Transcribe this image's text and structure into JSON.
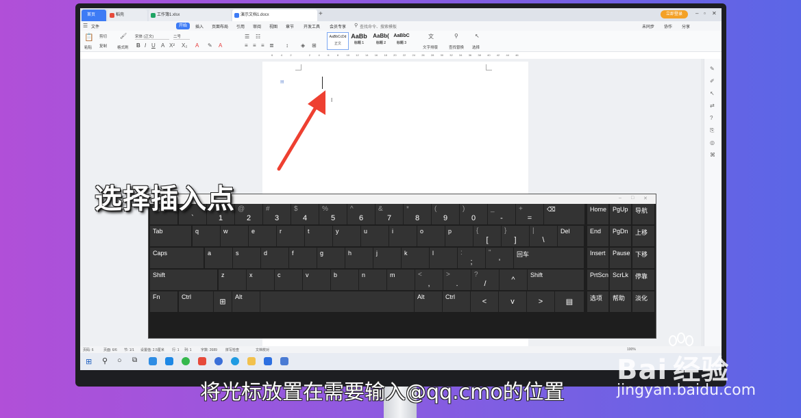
{
  "overlay": {
    "caption_top": "选择插入点",
    "caption_bottom": "将光标放置在需要输入@qq.cmo的位置",
    "watermark_brand": "Bai",
    "watermark_sub": "经验",
    "watermark_url": "jingyan.baidu.com"
  },
  "app": {
    "tabs": [
      {
        "label": "首页",
        "color": "#ffffff"
      },
      {
        "label": "稻壳",
        "color": "#e64a3b"
      },
      {
        "label": "工作簿1.xlsx",
        "color": "#1fa463"
      },
      {
        "label": "演示文档1.docx",
        "color": "#3d7bf5"
      }
    ],
    "login_label": "立即登录",
    "menu": [
      "文件",
      "开始",
      "插入",
      "页面布局",
      "引用",
      "审阅",
      "视图",
      "章节",
      "开发工具",
      "会员专享",
      "查找命令、搜索模板"
    ],
    "menu_right": [
      "未同步",
      "协作",
      "分享"
    ],
    "ribbon": {
      "paste": "粘贴",
      "cut": "剪切",
      "copy": "复制",
      "format_painter": "格式刷",
      "font_name": "宋体 (正文)",
      "font_size": "二号",
      "styles": [
        {
          "preview": "AaBbCcDd",
          "name": "正文"
        },
        {
          "preview": "AaBb",
          "name": "标题 1"
        },
        {
          "preview": "AaBb(",
          "name": "标题 2"
        },
        {
          "preview": "AaBbC",
          "name": "标题 3"
        }
      ],
      "text_layout": "文字排版",
      "find_replace": "查找替换",
      "select": "选择"
    },
    "ruler_marks": [
      "6",
      "4",
      "2",
      "",
      "2",
      "4",
      "6",
      "8",
      "10",
      "12",
      "14",
      "16",
      "18",
      "20",
      "22",
      "24",
      "26",
      "28",
      "30",
      "32",
      "34",
      "36",
      "38",
      "40",
      "42",
      "44",
      "46"
    ],
    "status": {
      "page_count": "页码: 6",
      "pages": "页面: 6/6",
      "section": "节: 1/1",
      "setting": "设置值: 2.5厘米",
      "row": "行: 1",
      "col": "列: 1",
      "words": "字数: 2689",
      "spell": "拼写检查",
      "proof": "文档校对",
      "zoom": "100%"
    }
  },
  "keyboard": {
    "row1": [
      {
        "main": "Esc"
      },
      {
        "shift": "~",
        "base": "`"
      },
      {
        "shift": "!",
        "base": "1"
      },
      {
        "shift": "@",
        "base": "2"
      },
      {
        "shift": "#",
        "base": "3"
      },
      {
        "shift": "$",
        "base": "4"
      },
      {
        "shift": "%",
        "base": "5"
      },
      {
        "shift": "^",
        "base": "6"
      },
      {
        "shift": "&",
        "base": "7"
      },
      {
        "shift": "*",
        "base": "8"
      },
      {
        "shift": "(",
        "base": "9"
      },
      {
        "shift": ")",
        "base": "0"
      },
      {
        "shift": "_",
        "base": "-"
      },
      {
        "shift": "+",
        "base": "="
      },
      {
        "main": "⌫"
      },
      {
        "main": "Home"
      },
      {
        "main": "PgUp"
      },
      {
        "main": "导航"
      }
    ],
    "row2": [
      {
        "main": "Tab"
      },
      {
        "main": "q"
      },
      {
        "main": "w"
      },
      {
        "main": "e"
      },
      {
        "main": "r"
      },
      {
        "main": "t"
      },
      {
        "main": "y"
      },
      {
        "main": "u"
      },
      {
        "main": "i"
      },
      {
        "main": "o"
      },
      {
        "main": "p"
      },
      {
        "shift": "{",
        "base": "["
      },
      {
        "shift": "}",
        "base": "]"
      },
      {
        "shift": "|",
        "base": "\\"
      },
      {
        "main": "Del"
      },
      {
        "main": "End"
      },
      {
        "main": "PgDn"
      },
      {
        "main": "上移"
      }
    ],
    "row3": [
      {
        "main": "Caps"
      },
      {
        "main": "a"
      },
      {
        "main": "s"
      },
      {
        "main": "d"
      },
      {
        "main": "f"
      },
      {
        "main": "g"
      },
      {
        "main": "h"
      },
      {
        "main": "j"
      },
      {
        "main": "k"
      },
      {
        "main": "l"
      },
      {
        "shift": ":",
        "base": ";"
      },
      {
        "shift": "\"",
        "base": "'"
      },
      {
        "main": "回车"
      },
      {
        "main": "Insert"
      },
      {
        "main": "Pause"
      },
      {
        "main": "下移"
      }
    ],
    "row4": [
      {
        "main": "Shift"
      },
      {
        "main": "z"
      },
      {
        "main": "x"
      },
      {
        "main": "c"
      },
      {
        "main": "v"
      },
      {
        "main": "b"
      },
      {
        "main": "n"
      },
      {
        "main": "m"
      },
      {
        "shift": "<",
        "base": ","
      },
      {
        "shift": ">",
        "base": "."
      },
      {
        "shift": "?",
        "base": "/"
      },
      {
        "center": "^"
      },
      {
        "main": "Shift"
      },
      {
        "main": "PrtScn"
      },
      {
        "main": "ScrLk"
      },
      {
        "main": "停靠"
      }
    ],
    "row5": [
      {
        "main": "Fn"
      },
      {
        "main": "Ctrl"
      },
      {
        "center": "⊞"
      },
      {
        "main": "Alt"
      },
      {
        "main": ""
      },
      {
        "main": "Alt"
      },
      {
        "main": "Ctrl"
      },
      {
        "center": "<"
      },
      {
        "center": "v"
      },
      {
        "center": ">"
      },
      {
        "center": "▤"
      },
      {
        "main": "选项"
      },
      {
        "main": "帮助"
      },
      {
        "main": "淡化"
      }
    ]
  }
}
